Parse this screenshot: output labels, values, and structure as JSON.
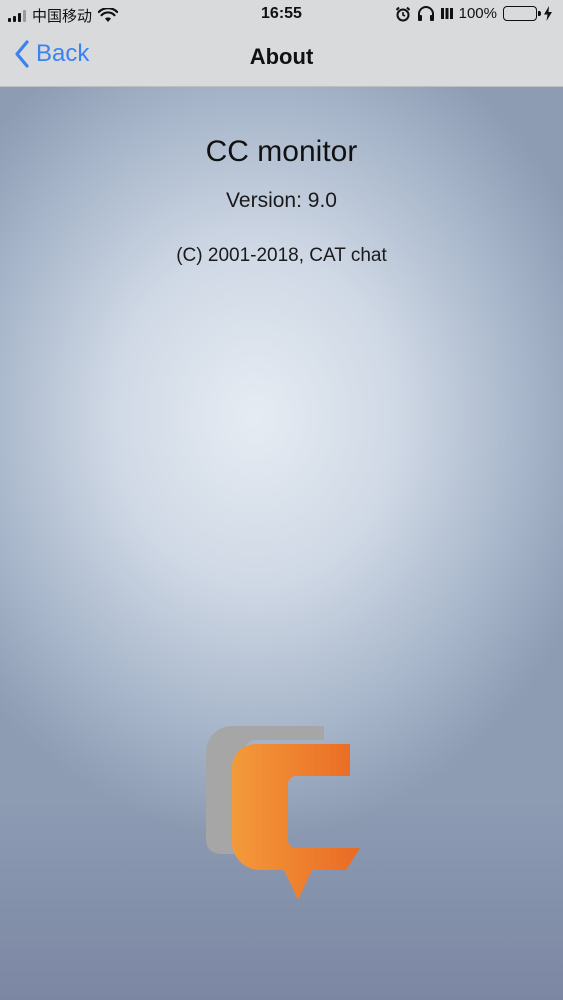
{
  "status_bar": {
    "carrier": "中国移动",
    "time": "16:55",
    "battery_percent": "100%",
    "icons": [
      "signal-icon",
      "wifi-icon",
      "alarm-icon",
      "headphones-icon",
      "battery-icon",
      "charging-bolt-icon"
    ]
  },
  "nav": {
    "back_label": "Back",
    "title": "About"
  },
  "about": {
    "app_name": "CC monitor",
    "version": "Version: 9.0",
    "copyright": "(C) 2001-2018, CAT chat"
  },
  "logo": {
    "icon": "cc-logo-icon",
    "colors": {
      "grey": "#a6a6a6",
      "orange_start": "#f39a3a",
      "orange_end": "#ea6a24"
    }
  },
  "colors": {
    "accent": "#3b82f0",
    "battery_fill": "#4cd964",
    "topbar_bg": "#d9dadc"
  }
}
